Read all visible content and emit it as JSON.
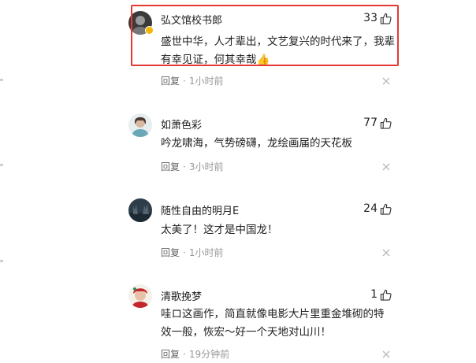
{
  "comments": [
    {
      "username": "弘文馆校书郎",
      "likes": "33",
      "content": "盛世中华，人才辈出，文艺复兴的时代来了，我辈有幸见证，何其幸哉👍",
      "reply_label": "回复",
      "separator": "·",
      "time": "1小时前",
      "avatar_icon": "user-avatar-icon",
      "highlighted": true
    },
    {
      "username": "如萧色彩",
      "likes": "77",
      "content": "吟龙啸海，气势磅礴，龙绘画届的天花板",
      "reply_label": "回复",
      "separator": "·",
      "time": "3小时前",
      "avatar_icon": "user-avatar-icon"
    },
    {
      "username": "随性自由的明月E",
      "likes": "24",
      "content": "太美了！这才是中国龙！",
      "reply_label": "回复",
      "separator": "·",
      "time": "1小时前",
      "avatar_icon": "user-avatar-icon"
    },
    {
      "username": "清歌挽梦",
      "likes": "1",
      "content": "哇ロ这画作，简直就像电影大片里重金堆砌的特效一般，恢宏～好一个天地对山川！",
      "reply_label": "回复",
      "separator": "·",
      "time": "19分钟前",
      "avatar_icon": "user-avatar-icon"
    }
  ],
  "colors": {
    "highlight_border": "#e53935",
    "meta_text": "#999999",
    "primary_text": "#222222"
  },
  "icons": {
    "like": "thumbs-up-icon",
    "close": "close-icon"
  }
}
